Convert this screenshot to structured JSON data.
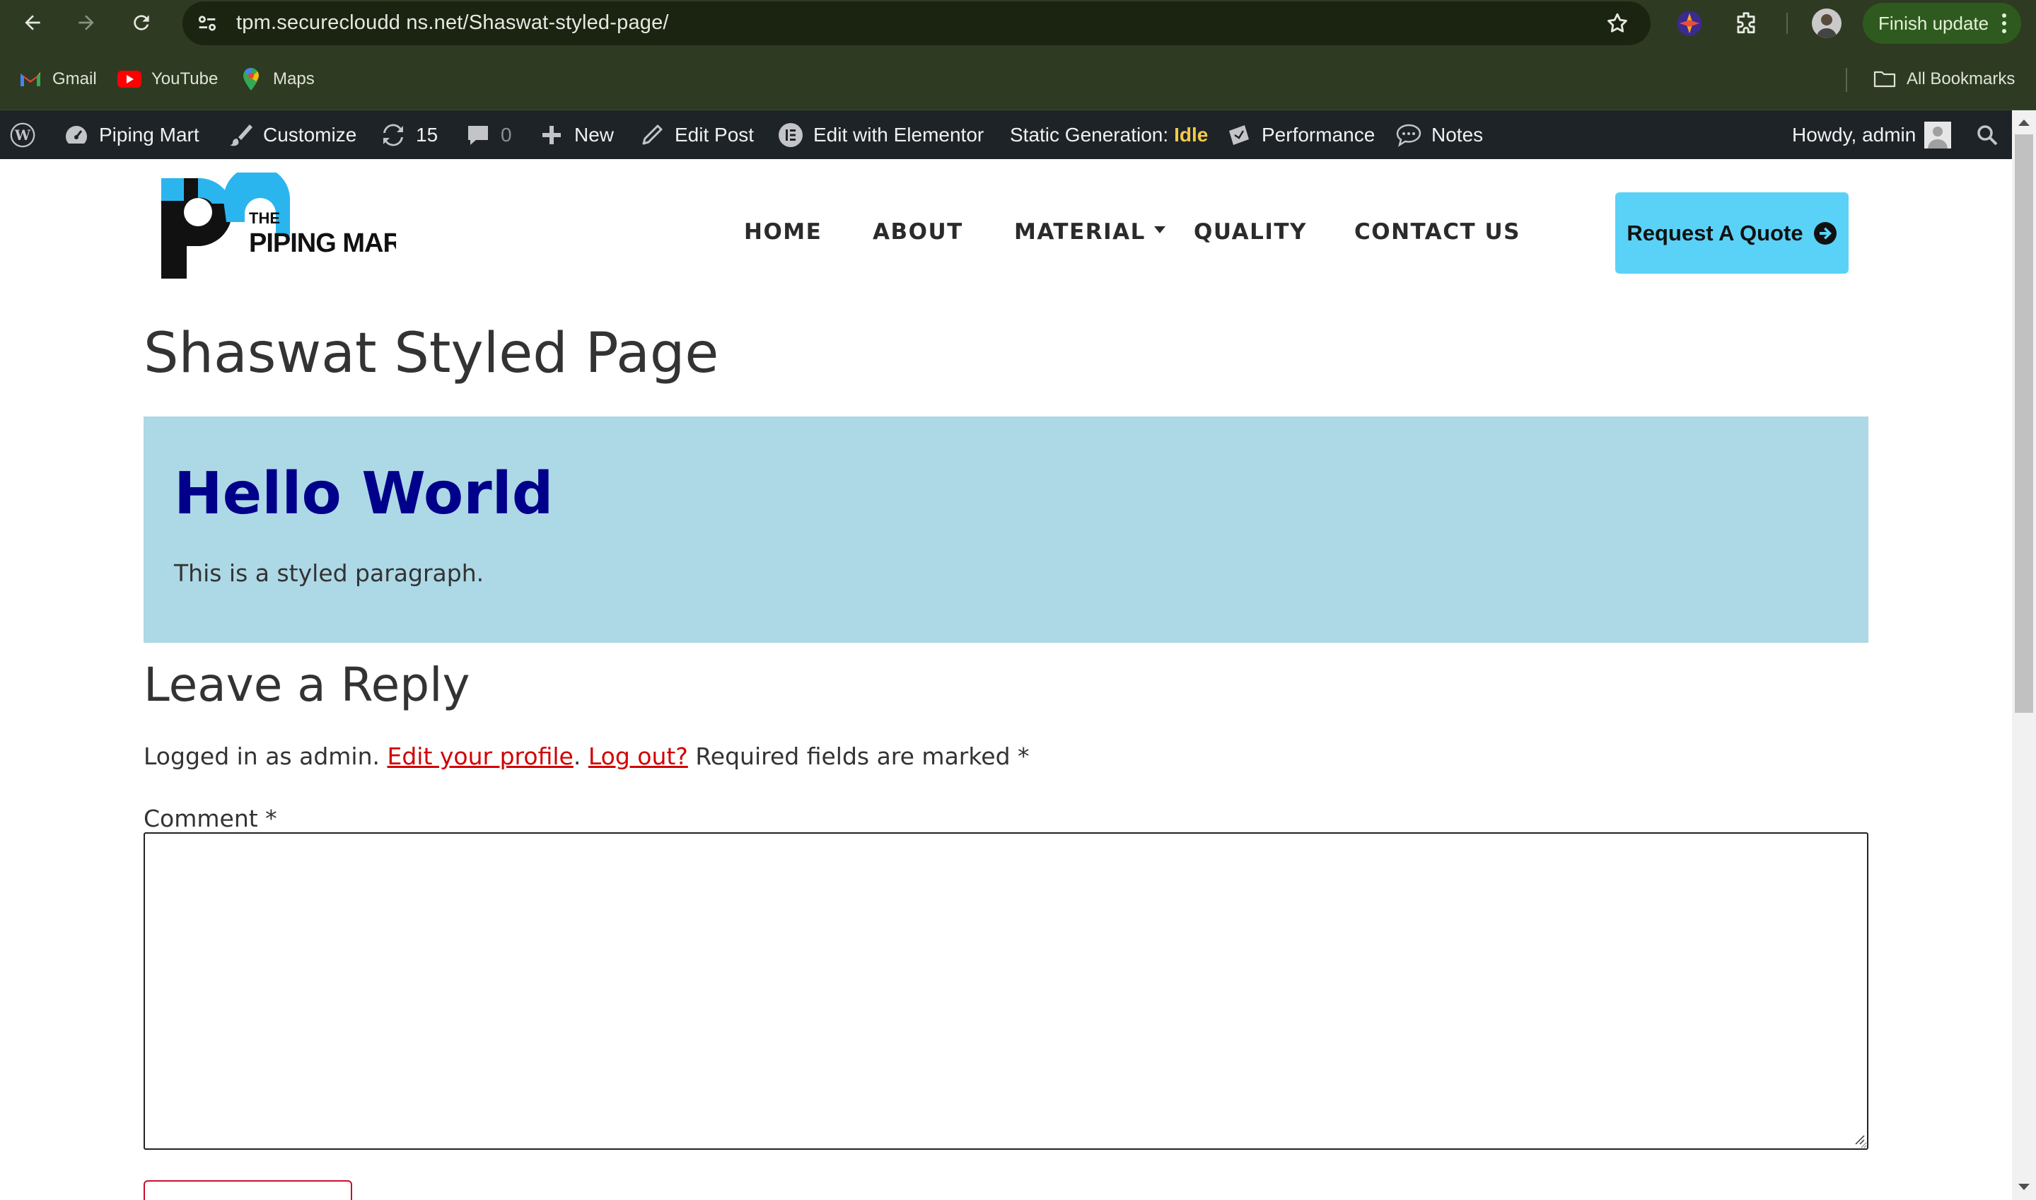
{
  "browser": {
    "url": "tpm.securecloudd ns.net/Shaswat-styled-page/",
    "finish_update": "Finish update",
    "bookmarks": [
      {
        "label": "Gmail",
        "icon": "gmail-icon"
      },
      {
        "label": "YouTube",
        "icon": "youtube-icon"
      },
      {
        "label": "Maps",
        "icon": "maps-icon"
      }
    ],
    "all_bookmarks": "All Bookmarks"
  },
  "adminbar": {
    "site_name": "Piping Mart",
    "customize": "Customize",
    "updates_count": "15",
    "comments_count": "0",
    "new": "New",
    "edit_post": "Edit Post",
    "edit_elementor": "Edit with Elementor",
    "static_generation": "Static Generation:",
    "static_status": "Idle",
    "performance": "Performance",
    "notes": "Notes",
    "howdy": "Howdy, admin"
  },
  "site": {
    "logo_text_top": "THE",
    "logo_text_bottom": "PIPING MART",
    "menu": [
      "HOME",
      "ABOUT",
      "MATERIAL",
      "QUALITY",
      "CONTACT US"
    ],
    "quote_button": "Request A Quote"
  },
  "page": {
    "title": "Shaswat Styled Page",
    "hello_title": "Hello World",
    "hello_paragraph": "This is a styled paragraph."
  },
  "reply": {
    "title": "Leave a Reply",
    "logged_in_prefix": "Logged in as admin.",
    "edit_profile": "Edit your profile",
    "separator": ".",
    "log_out": "Log out?",
    "required_note": "Required fields are marked *",
    "comment_label": "Comment *"
  },
  "colors": {
    "link": "#d10000",
    "hello_bg": "#add8e6",
    "hello_title": "#00008b",
    "quote_bg": "#5ad2f8",
    "static_idle": "#f2c94c"
  }
}
